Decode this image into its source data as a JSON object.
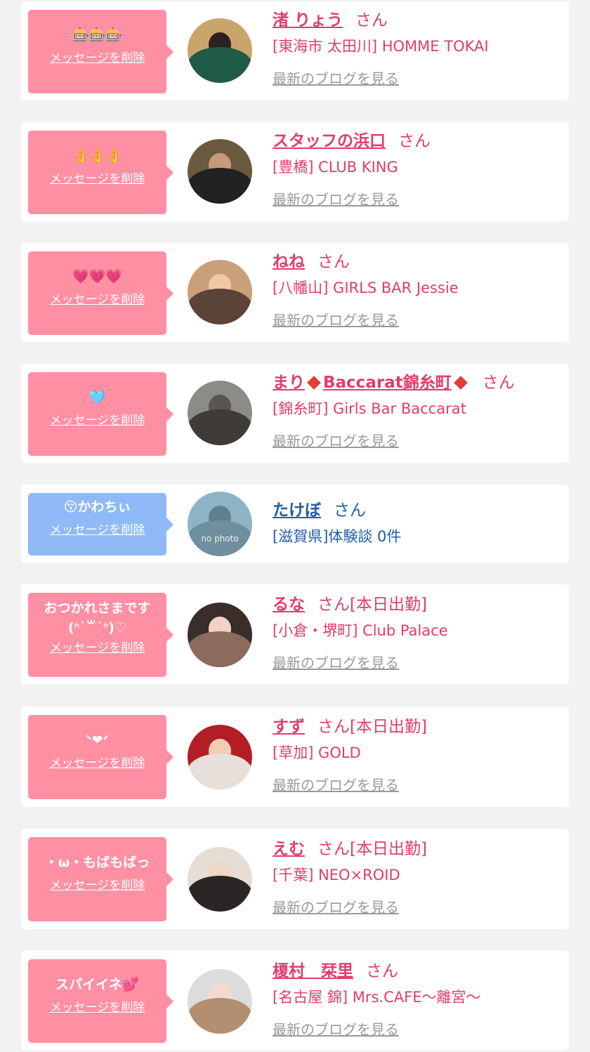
{
  "delete_label": "メッセージを削除",
  "blog_label": "最新のブログを見る",
  "honorific": "さん",
  "colors": {
    "pink": "#ff8fa3",
    "blue_bubble": "#8fbaf7",
    "name_pink": "#e23d6a",
    "name_blue": "#1f5fa6"
  },
  "items": [
    {
      "message": "🎰🎰🎰",
      "name": "渚 りょう",
      "shop": "[東海市 太田川] HOMME TOKAI",
      "status": ""
    },
    {
      "message": "👌👌👌",
      "name": "スタッフの浜口",
      "shop": "[豊橋] CLUB KING",
      "status": ""
    },
    {
      "message": "💗💗💗",
      "name": "ねね",
      "shop": "[八幡山] GIRLS BAR Jessie",
      "status": ""
    },
    {
      "message": "🩵",
      "name_parts": [
        "まり",
        "Baccarat錦糸町"
      ],
      "shop": "[錦糸町] Girls Bar Baccarat",
      "status": ""
    },
    {
      "message": "😚かわちぃ",
      "name": "たけぼ",
      "shop": "[滋賀県]体験談 0件",
      "status": "",
      "avatar_text": "no photo"
    },
    {
      "message": "おつかれさまです\n(ᐢ˙꒳˙ᐢ)♡",
      "name": "るな",
      "shop": "[小倉・堺町] Club Palace",
      "status": "[本日出勤]"
    },
    {
      "message": "ᐠ❤ᐟ",
      "name": "すず",
      "shop": "[草加] GOLD",
      "status": "[本日出勤]"
    },
    {
      "message": "・ω・もばもばっ",
      "name": "えむ",
      "shop": "[千葉] NEO×ROID",
      "status": "[本日出勤]"
    },
    {
      "message": "スパイイネ💕",
      "name": "榎村　栞里",
      "shop": "[名古屋 錦] Mrs.CAFE〜離宮〜",
      "status": ""
    }
  ]
}
